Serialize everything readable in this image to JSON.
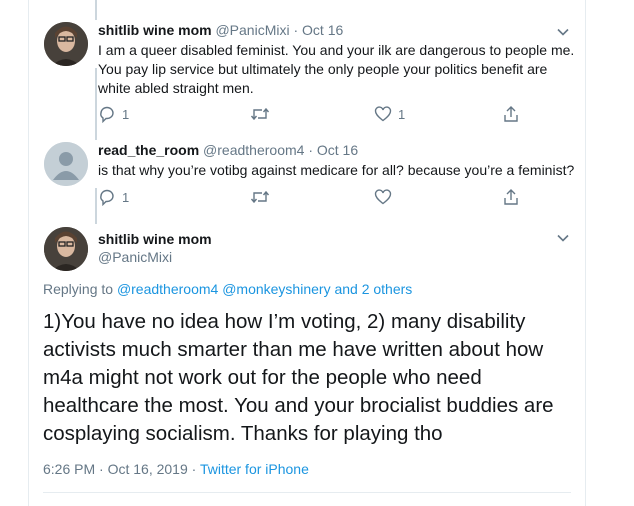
{
  "tweets": [
    {
      "name": "shitlib wine mom",
      "handle": "@PanicMixi",
      "dot": "·",
      "date": "Oct 16",
      "text": "I am a queer disabled feminist. You and your ilk are dangerous to people me. You pay lip service but ultimately the only people your politics benefit are white abled straight men.",
      "reply_count": "1",
      "like_count": "1"
    },
    {
      "name": "read_the_room",
      "handle": "@readtheroom4",
      "dot": "·",
      "date": "Oct 16",
      "text": "is that why you’re votibg against medicare for all? because you’re a feminist?",
      "reply_count": "1",
      "like_count": ""
    }
  ],
  "main_tweet": {
    "name": "shitlib wine mom",
    "handle": "@PanicMixi",
    "replying_prefix": "Replying to",
    "replying_to": "@readtheroom4 @monkeyshinery and 2 others",
    "text": "1)You have no idea how I’m voting, 2) many disability activists much smarter than me have written about how m4a might not work out for the people who need healthcare the most. You and your brocialist buddies are cosplaying socialism. Thanks for playing tho",
    "timestamp": "6:26 PM · Oct 16, 2019 ·",
    "source": "Twitter for iPhone"
  },
  "colors": {
    "accent": "#1b95e0",
    "muted": "#657786",
    "text": "#14171a",
    "border": "#e6ecf0"
  },
  "icons": [
    "reply-icon",
    "retweet-icon",
    "like-icon",
    "share-icon",
    "chevron-down-icon"
  ]
}
